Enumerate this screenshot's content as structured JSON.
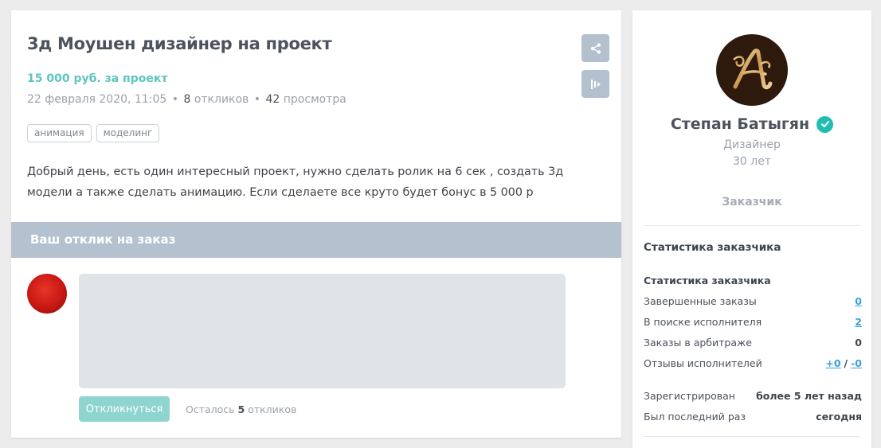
{
  "job": {
    "title": "3д Моушен дизайнер на проект",
    "price": "15 000 руб. за проект",
    "date": "22 февраля 2020, 11:05",
    "responses_count": "8",
    "responses_label": "откликов",
    "views_count": "42",
    "views_label": "просмотра",
    "tags": [
      "анимация",
      "моделинг"
    ],
    "description": "Добрый день, есть один интересный проект, нужно сделать ролик на 6 сек , создать 3д модели а также сделать анимацию. Если сделаете все круто будет бонус в 5 000 р"
  },
  "response": {
    "heading": "Ваш отклик на заказ",
    "submit_label": "Откликнуться",
    "remaining_prefix": "Осталось",
    "remaining_count": "5",
    "remaining_suffix": "откликов"
  },
  "profile": {
    "name": "Степан Батыгян",
    "role": "Дизайнер",
    "age": "30 лет",
    "type": "Заказчик",
    "stats_heading": "Статистика заказчика",
    "stats_subheading": "Статистика заказчика",
    "stats": [
      {
        "label": "Завершенные заказы",
        "value": "0"
      },
      {
        "label": "В поиске исполнителя",
        "value": "2"
      },
      {
        "label": "Заказы в арбитраже",
        "value": "0"
      }
    ],
    "reviews": {
      "label": "Отзывы исполнителей",
      "positive": "+0",
      "negative": "-0"
    },
    "registered": {
      "label": "Зарегистрирован",
      "value": "более 5 лет назад"
    },
    "last_seen": {
      "label": "Был последний раз",
      "value": "сегодня"
    }
  },
  "colors": {
    "accent": "#5bc6be",
    "side_buttons": "#b3c0ce",
    "response_bar": "#b4c1cf",
    "link": "#3aa0d8",
    "verified": "#22bcb0"
  },
  "icons": {
    "share": "share-icon",
    "report": "report-icon",
    "verified": "verified-check-icon"
  }
}
